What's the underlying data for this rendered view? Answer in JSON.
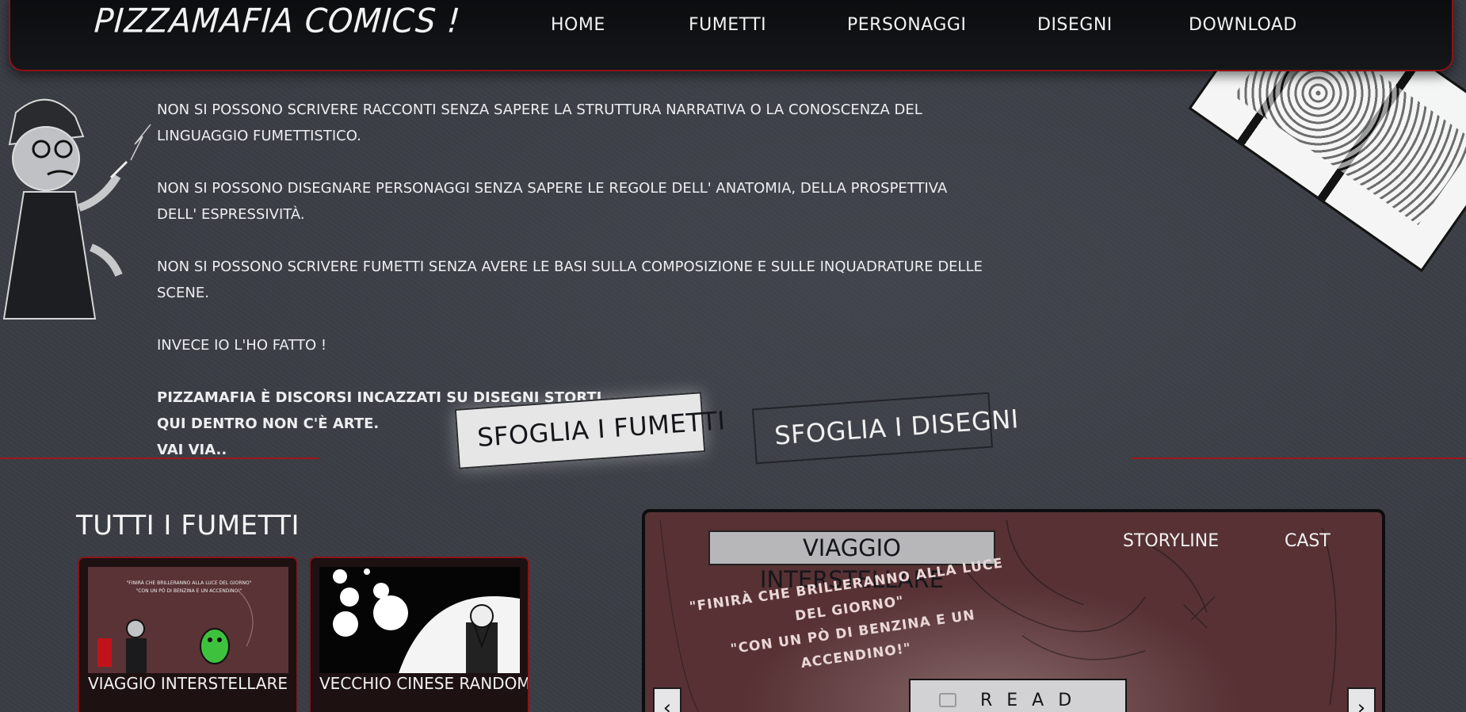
{
  "nav": {
    "logo": "PIZZAMAFIA COMICS !",
    "items": [
      "HOME",
      "FUMETTI",
      "PERSONAGGI",
      "DISEGNI",
      "DOWNLOAD"
    ]
  },
  "intro": {
    "p1": "NON SI POSSONO SCRIVERE RACCONTI SENZA SAPERE LA STRUTTURA NARRATIVA O LA CONOSCENZA DEL LINGUAGGIO FUMETTISTICO.",
    "p2": "NON SI POSSONO DISEGNARE PERSONAGGI SENZA SAPERE LE REGOLE DELL' ANATOMIA, DELLA PROSPETTIVA DELL' ESPRESSIVITÀ.",
    "p3": "NON SI POSSONO SCRIVERE FUMETTI SENZA AVERE LE BASI SULLA COMPOSIZIONE E SULLE INQUADRATURE DELLE SCENE.",
    "p4": "INVECE IO L'HO FATTO !",
    "p5a": "PIZZAMAFIA È DISCORSI INCAZZATI SU DISEGNI STORTI,",
    "p5b": "QUI DENTRO NON C'È ARTE.",
    "p5c": "VAI VIA.."
  },
  "buttons": {
    "browse_comics": "SFOGLIA I FUMETTI",
    "browse_drawings": "SFOGLIA I DISEGNI"
  },
  "comics_section": {
    "title": "TUTTI I FUMETTI",
    "cards": [
      {
        "label": "VIAGGIO INTERSTELLARE",
        "thumb_quote_1": "\"FINIRÀ CHE BRILLERANNO ALLA LUCE DEL GIORNO\"",
        "thumb_quote_2": "\"CON UN PÒ DI BENZINA E UN ACCENDINO!\""
      },
      {
        "label": "VECCHIO CINESE RANDOM"
      }
    ]
  },
  "feature": {
    "title": "VIAGGIO INTERSTELLARE",
    "tabs": [
      "STORYLINE",
      "CAST"
    ],
    "quote_line1": "\"FINIRÀ CHE BRILLERANNO ALLA LUCE DEL GIORNO\"",
    "quote_line2": "\"CON UN PÒ DI BENZINA E UN ACCENDINO!\"",
    "read_label": "READ",
    "prev_arrow": "‹",
    "next_arrow": "›"
  },
  "colors": {
    "accent_red": "#a3151a",
    "background": "#3a3d44",
    "navbar": "#0b0c0e",
    "feature_bg": "#573134"
  },
  "icons": [
    "prev-arrow-icon",
    "next-arrow-icon",
    "checkbox-icon"
  ]
}
